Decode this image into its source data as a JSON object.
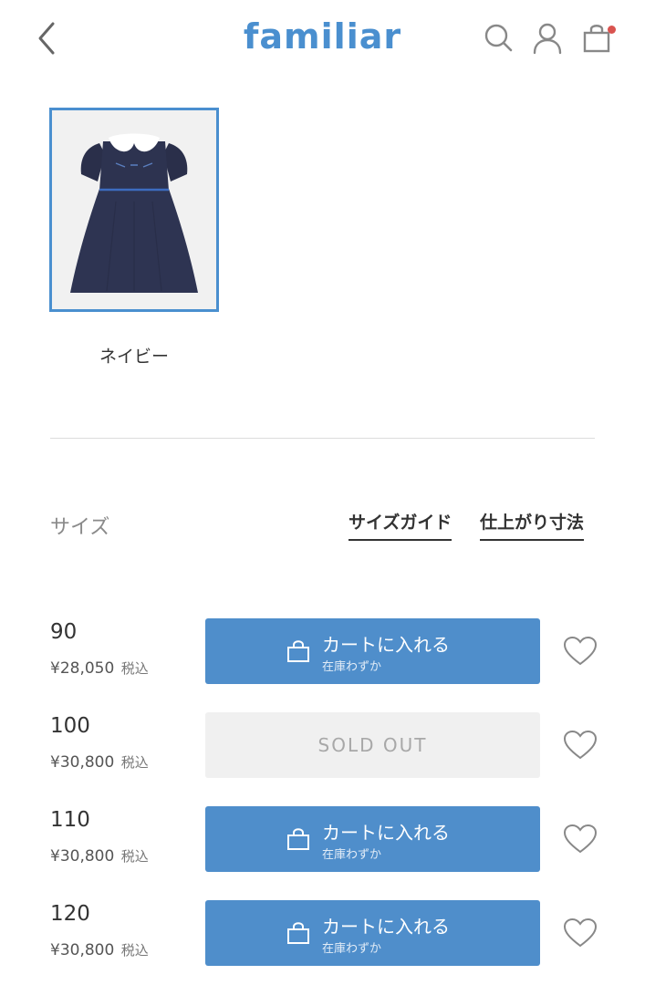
{
  "header": {
    "logo": "familiar",
    "icons": [
      "back-chevron-icon",
      "search-icon",
      "account-icon",
      "cart-icon"
    ],
    "cart_badge_color": "#d9534f"
  },
  "colors": {
    "brand": "#4a8fcf",
    "cart_button": "#4f8ecb",
    "soldout_bg": "#f0f0f0"
  },
  "color_option": {
    "label": "ネイビー",
    "selected": true
  },
  "size_section": {
    "heading": "サイズ",
    "size_guide_link": "サイズガイド",
    "finished_dims_link": "仕上がり寸法"
  },
  "sizes": [
    {
      "size": "90",
      "price": "¥28,050",
      "tax": "税込",
      "status": "in_stock",
      "button_label": "カートに入れる",
      "stock_note": "在庫わずか"
    },
    {
      "size": "100",
      "price": "¥30,800",
      "tax": "税込",
      "status": "sold_out",
      "button_label": "SOLD OUT"
    },
    {
      "size": "110",
      "price": "¥30,800",
      "tax": "税込",
      "status": "in_stock",
      "button_label": "カートに入れる",
      "stock_note": "在庫わずか"
    },
    {
      "size": "120",
      "price": "¥30,800",
      "tax": "税込",
      "status": "in_stock",
      "button_label": "カートに入れる",
      "stock_note": "在庫わずか"
    }
  ]
}
